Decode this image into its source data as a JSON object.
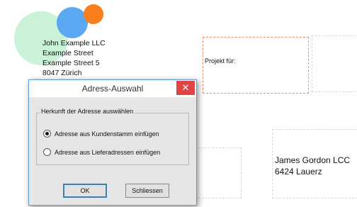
{
  "sender": {
    "lines": [
      "John Example LLC",
      "Example Street",
      "Example Street 5",
      "8047 Zürich"
    ]
  },
  "project": {
    "label": "Projekt für:"
  },
  "recipient": {
    "lines": [
      "James Gordon LCC",
      "6424 Lauerz"
    ]
  },
  "dialog": {
    "title": "Adress-Auswahl",
    "close_symbol": "✕",
    "group_label": "Herkunft der Adresse auswählen",
    "options": [
      {
        "label": "Adresse aus Kundenstamm einfügen",
        "selected": true
      },
      {
        "label": "Adresse aus Lieferadressen einfügen",
        "selected": false
      }
    ],
    "ok_label": "OK",
    "close_label": "Schliessen"
  },
  "colors": {
    "logo_green": "#c9f2d6",
    "logo_blue": "#5aa8f2",
    "logo_orange": "#f77e1b",
    "close_button": "#e04343",
    "project_border": "#f08a6a"
  },
  "icons": {
    "logo": "circles-logo-icon",
    "close": "close-icon"
  }
}
